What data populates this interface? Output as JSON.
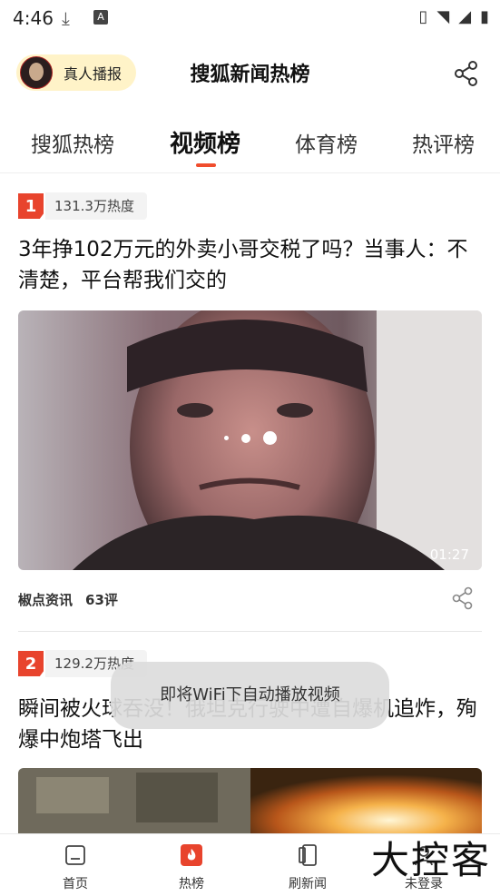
{
  "status_bar": {
    "time": "4:46"
  },
  "header": {
    "broadcast_label": "真人播报",
    "title": "搜狐新闻热榜"
  },
  "tabs": [
    {
      "label": "搜狐热榜"
    },
    {
      "label": "视频榜"
    },
    {
      "label": "体育榜"
    },
    {
      "label": "热评榜"
    }
  ],
  "items": [
    {
      "rank": "1",
      "heat": "131.3万热度",
      "headline": "3年挣102万元的外卖小哥交税了吗？当事人：不清楚，平台帮我们交的",
      "duration": "01:27",
      "source": "椒点资讯",
      "comments": "63评"
    },
    {
      "rank": "2",
      "heat": "129.2万热度",
      "headline": "瞬间被火球吞没！俄坦克行驶中遭自爆机追炸，殉爆中炮塔飞出"
    }
  ],
  "toast": "即将WiFi下自动播放视频",
  "bottom_nav": [
    {
      "label": "首页"
    },
    {
      "label": "热榜"
    },
    {
      "label": "刷新闻"
    },
    {
      "label": "未登录"
    }
  ],
  "watermark": "大控客",
  "colors": {
    "accent": "#e8442d",
    "broadcast_bg": "#fff3c8"
  }
}
